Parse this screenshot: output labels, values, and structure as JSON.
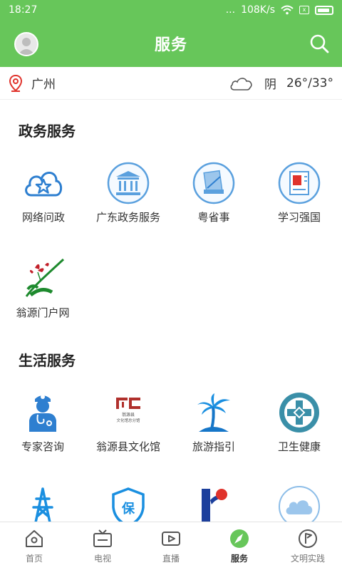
{
  "status_bar": {
    "time": "18:27",
    "dots": "...",
    "net_speed": "108K/s",
    "sim": "x"
  },
  "header": {
    "title": "服务"
  },
  "location": {
    "city": "广州",
    "weather_text": "阴",
    "temperature": "26°/33°"
  },
  "sections": [
    {
      "title": "政务服务",
      "items": [
        {
          "label": "网络问政",
          "icon": "cloud-star-icon"
        },
        {
          "label": "广东政务服务",
          "icon": "government-building-icon"
        },
        {
          "label": "粤省事",
          "icon": "document-icon"
        },
        {
          "label": "学习强国",
          "icon": "book-flag-icon"
        },
        {
          "label": "翁源门户网",
          "icon": "orchid-logo-icon"
        }
      ]
    },
    {
      "title": "生活服务",
      "items": [
        {
          "label": "专家咨询",
          "icon": "doctor-icon"
        },
        {
          "label": "翁源县文化馆",
          "icon": "culture-hall-logo"
        },
        {
          "label": "旅游指引",
          "icon": "palm-island-icon"
        },
        {
          "label": "卫生健康",
          "icon": "health-cross-icon"
        },
        {
          "label": "",
          "icon": "power-tower-icon"
        },
        {
          "label": "",
          "icon": "insurance-shield-icon"
        },
        {
          "label": "",
          "icon": "red-logo-icon"
        },
        {
          "label": "",
          "icon": "cloud-icon"
        }
      ]
    }
  ],
  "culture_logo_text": {
    "line1": "翁源县",
    "line2": "文化馆总分馆"
  },
  "insurance_char": "保",
  "tabs": [
    {
      "label": "首页",
      "icon": "home-icon",
      "active": false
    },
    {
      "label": "电视",
      "icon": "tv-icon",
      "active": false
    },
    {
      "label": "直播",
      "icon": "live-video-icon",
      "active": false
    },
    {
      "label": "服务",
      "icon": "compass-icon",
      "active": true
    },
    {
      "label": "文明实践",
      "icon": "flag-circle-icon",
      "active": false
    }
  ],
  "colors": {
    "primary_green": "#67c65a",
    "icon_blue": "#2e7fd0",
    "light_blue": "#5aa0de",
    "accent_red": "#e0332c"
  }
}
